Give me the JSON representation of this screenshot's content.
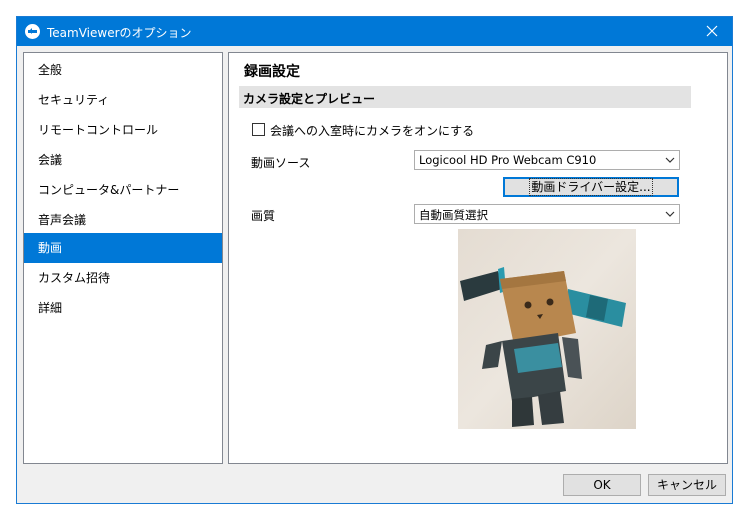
{
  "window": {
    "title": "TeamViewerのオプション",
    "accent_color": "#0078d7"
  },
  "sidebar": {
    "selected_index": 6,
    "items": [
      {
        "label": "全般"
      },
      {
        "label": "セキュリティ"
      },
      {
        "label": "リモートコントロール"
      },
      {
        "label": "会議"
      },
      {
        "label": "コンピュータ&パートナー"
      },
      {
        "label": "音声会議"
      },
      {
        "label": "動画"
      },
      {
        "label": "カスタム招待"
      },
      {
        "label": "詳細"
      }
    ]
  },
  "content": {
    "heading": "録画設定",
    "section_title": "カメラ設定とプレビュー",
    "camera_checkbox": {
      "label": "会議への入室時にカメラをオンにする",
      "checked": false
    },
    "video_source": {
      "label": "動画ソース",
      "value": "Logicool HD Pro Webcam C910"
    },
    "driver_button": {
      "label": "動画ドライバー設定..."
    },
    "quality": {
      "label": "画質",
      "value": "自動画質選択"
    },
    "preview": {
      "icon": "webcam-preview-image"
    }
  },
  "footer": {
    "ok_label": "OK",
    "cancel_label": "キャンセル"
  }
}
